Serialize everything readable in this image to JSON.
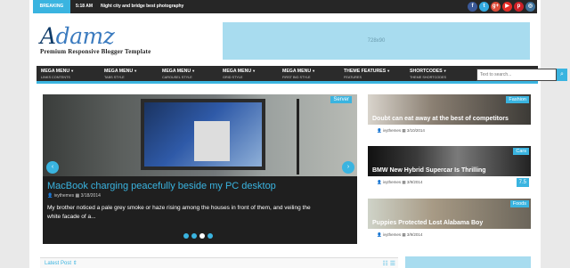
{
  "topbar": {
    "breaking_label": "BREAKING NEWS",
    "time": "5:18 AM",
    "headline": "Night city and bridge best photography",
    "socials": [
      {
        "icon": "facebook-icon",
        "glyph": "f",
        "color": "#3b5998"
      },
      {
        "icon": "twitter-icon",
        "glyph": "t",
        "color": "#33a9e0"
      },
      {
        "icon": "google-plus-icon",
        "glyph": "g+",
        "color": "#dd4b39"
      },
      {
        "icon": "youtube-icon",
        "glyph": "▶",
        "color": "#e52d27"
      },
      {
        "icon": "pinterest-icon",
        "glyph": "p",
        "color": "#cb2027"
      },
      {
        "icon": "instagram-icon",
        "glyph": "◎",
        "color": "#3f729b"
      }
    ]
  },
  "header": {
    "logo_first": "A",
    "logo_rest": "damz",
    "tagline": "Premium Responsive Blogger Template",
    "ad_text": "728x90"
  },
  "nav": {
    "items": [
      {
        "title": "MEGA MENU",
        "sub": "LINKS CONTENTS"
      },
      {
        "title": "MEGA MENU",
        "sub": "TABS STYLE"
      },
      {
        "title": "MEGA MENU",
        "sub": "CAROUSEL STYLE"
      },
      {
        "title": "MEGA MENU",
        "sub": "GRID STYLE"
      },
      {
        "title": "MEGA MENU",
        "sub": "FIRST BIG STYLE"
      },
      {
        "title": "THEME FEATURES",
        "sub": "FEATURES"
      },
      {
        "title": "SHORTCODES",
        "sub": "THEME SHORTCODES"
      }
    ],
    "search_placeholder": "Text to search...",
    "search_icon": "search-icon"
  },
  "slider": {
    "category": "Server",
    "title": "MacBook charging peacefully beside my PC desktop",
    "author": "ivythemes",
    "date": "3/18/2014",
    "excerpt": "My brother noticed a pale grey smoke or haze rising among the houses in front of them, and veiling the white facade of a...",
    "prev": "‹",
    "next": "›",
    "slides": 4,
    "active_slide": 3
  },
  "side_posts": [
    {
      "category": "Fashion",
      "title": "Doubt can eat away at the best of competitors",
      "author": "ivythemes",
      "date": "3/10/2014",
      "score": ""
    },
    {
      "category": "Cars",
      "title": "BMW New Hybrid Supercar Is Thrilling",
      "author": "ivythemes",
      "date": "3/9/2014",
      "score": "7.5"
    },
    {
      "category": "Foods",
      "title": "Puppies Protected Lost Alabama Boy",
      "author": "ivythemes",
      "date": "3/9/2014",
      "score": ""
    }
  ],
  "latest": {
    "label": "Latest Post",
    "sort_icon": "⇕",
    "view_icons": "☷ ☰"
  }
}
